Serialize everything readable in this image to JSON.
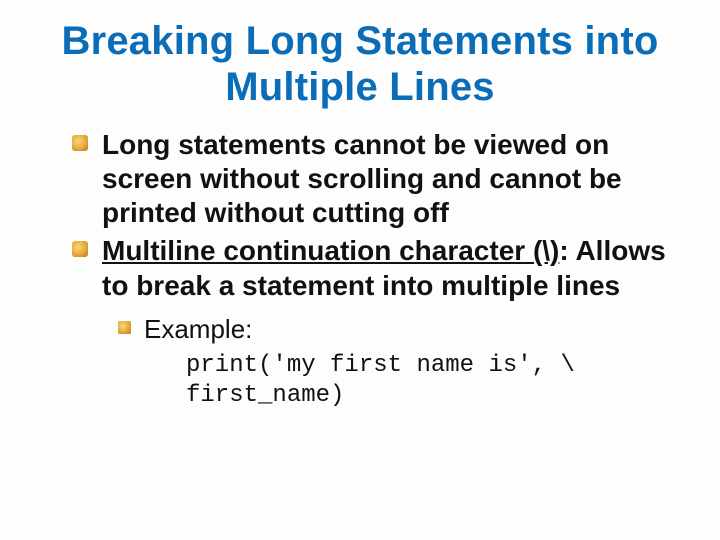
{
  "title": "Breaking Long Statements into Multiple Lines",
  "bullets": {
    "b1": "Long statements cannot be viewed on screen without scrolling and cannot be printed without cutting off",
    "b2_prefix": "Multiline continuation character (\\)",
    "b2_suffix": ": Allows to break a statement into multiple lines",
    "sub1": "Example:",
    "code_line1": "print('my first name is', \\",
    "code_line2": "first_name)"
  }
}
